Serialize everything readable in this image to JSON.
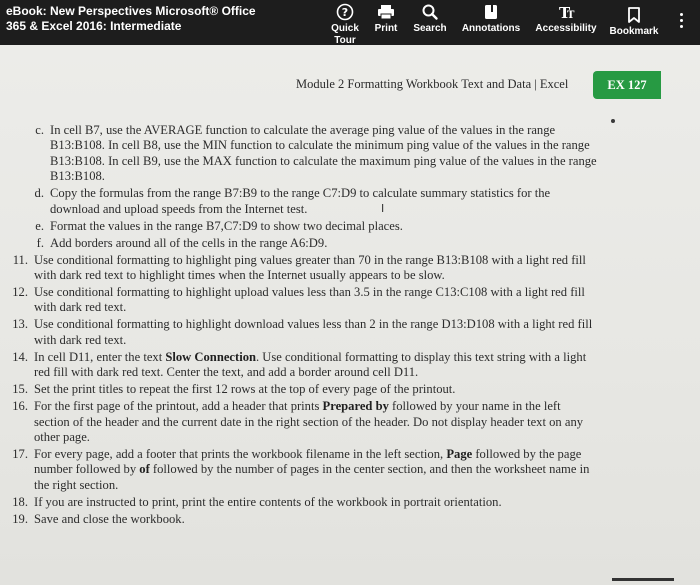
{
  "header": {
    "book_title_line1": "eBook: New Perspectives Microsoft® Office",
    "book_title_line2": "365 & Excel 2016: Intermediate",
    "tools": {
      "quick_tour_line1": "Quick",
      "quick_tour_line2": "Tour",
      "print": "Print",
      "search": "Search",
      "annotations": "Annotations",
      "accessibility": "Accessibility",
      "bookmark": "Bookmark"
    },
    "icons": [
      "question-circle-icon",
      "printer-icon",
      "magnifier-icon",
      "annotations-icon",
      "text-size-icon",
      "bookmark-icon",
      "kebab-menu-icon"
    ]
  },
  "page": {
    "running_head": "Module 2 Formatting Workbook Text and Data | Excel",
    "page_number": "EX 127"
  },
  "steps": [
    {
      "label": "c.",
      "text": "In cell B7, use the AVERAGE function to calculate the average ping value of the values in the range B13:B108. In cell B8, use the MIN function to calculate the minimum ping value of the values in the range B13:B108. In cell B9, use the MAX function to calculate the maximum ping value of the values in the range B13:B108."
    },
    {
      "label": "d.",
      "text": "Copy the formulas from the range B7:B9 to the range C7:D9 to calculate summary statistics for the download and upload speeds from the Internet test."
    },
    {
      "label": "e.",
      "text": "Format the values in the range B7,C7:D9 to show two decimal places."
    },
    {
      "label": "f.",
      "text": "Add borders around all of the cells in the range A6:D9."
    },
    {
      "label": "11.",
      "text": "Use conditional formatting to highlight ping values greater than 70 in the range B13:B108 with a light red fill with dark red text to highlight times when the Internet usually appears to be slow."
    },
    {
      "label": "12.",
      "text": "Use conditional formatting to highlight upload values less than 3.5 in the range C13:C108 with a light red fill with dark red text."
    },
    {
      "label": "13.",
      "text": "Use conditional formatting to highlight download values less than 2 in the range D13:D108 with a light red fill with dark red text."
    },
    {
      "label": "14.",
      "text_a": "In cell D11, enter the text ",
      "bold": "Slow Connection",
      "text_b": ". Use conditional formatting to display this text string with a light red fill with dark red text. Center the text, and add a border around cell D11."
    },
    {
      "label": "15.",
      "text": "Set the print titles to repeat the first 12 rows at the top of every page of the printout."
    },
    {
      "label": "16.",
      "text_a": "For the first page of the printout, add a header that prints ",
      "bold": "Prepared by",
      "text_b": " followed by your name in the left section of the header and the current date in the right section of the header. Do not display header text on any other page."
    },
    {
      "label": "17.",
      "text_a": "For every page, add a footer that prints the workbook filename in the left section, ",
      "bold": "Page",
      "text_b": " followed by the page number followed by ",
      "bold2": "of",
      "text_c": " followed by the number of pages in the center section, and then the worksheet name in the right section."
    },
    {
      "label": "18.",
      "text": "If you are instructed to print, print the entire contents of the workbook in portrait orientation."
    },
    {
      "label": "19.",
      "text": "Save and close the workbook."
    }
  ]
}
